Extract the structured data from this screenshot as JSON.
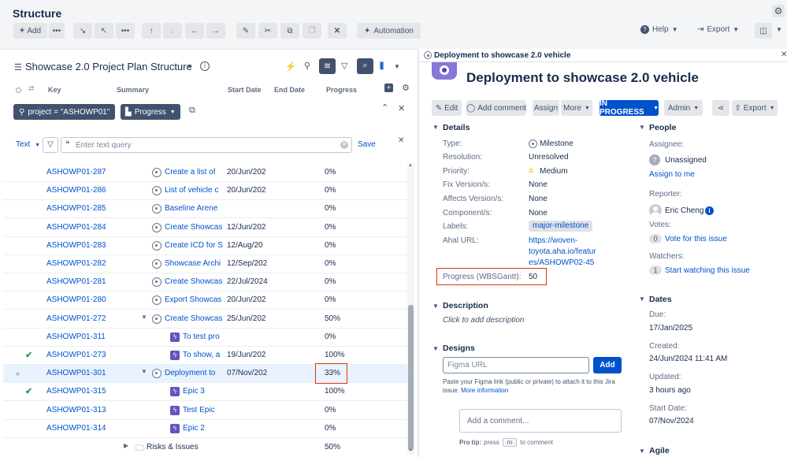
{
  "app": {
    "title": "Structure",
    "toolbar": {
      "add_label": "Add",
      "automation_label": "Automation",
      "help_label": "Help",
      "export_label": "Export"
    }
  },
  "structure": {
    "name": "Showcase 2.0 Project Plan Structure",
    "columns": {
      "key": "Key",
      "summary": "Summary",
      "start_date": "Start Date",
      "end_date": "End Date",
      "progress": "Progress"
    },
    "filter_chip": "project = \"ASHOWP01\"",
    "progress_chip": "Progress",
    "text_mode": "Text",
    "search_placeholder": "Enter text query",
    "save_label": "Save",
    "rows": [
      {
        "key": "ASHOWP01-287",
        "summary": "Create a list of",
        "start": "20/Jun/202",
        "progress": "0%",
        "type": "milestone",
        "indent": 0,
        "expand": "",
        "check": false,
        "dot": false
      },
      {
        "key": "ASHOWP01-286",
        "summary": "List of vehicle c",
        "start": "20/Jun/202",
        "progress": "0%",
        "type": "milestone",
        "indent": 0,
        "expand": "",
        "check": false,
        "dot": false
      },
      {
        "key": "ASHOWP01-285",
        "summary": "Baseline Arene",
        "start": "",
        "progress": "0%",
        "type": "milestone",
        "indent": 0,
        "expand": "",
        "check": false,
        "dot": false
      },
      {
        "key": "ASHOWP01-284",
        "summary": "Create Showcas",
        "start": "12/Jun/202",
        "progress": "0%",
        "type": "milestone",
        "indent": 0,
        "expand": "",
        "check": false,
        "dot": false
      },
      {
        "key": "ASHOWP01-283",
        "summary": "Create ICD for S",
        "start": "12/Aug/20",
        "progress": "0%",
        "type": "milestone",
        "indent": 0,
        "expand": "",
        "check": false,
        "dot": false
      },
      {
        "key": "ASHOWP01-282",
        "summary": "Showcase Archi",
        "start": "12/Sep/202",
        "progress": "0%",
        "type": "milestone",
        "indent": 0,
        "expand": "",
        "check": false,
        "dot": false
      },
      {
        "key": "ASHOWP01-281",
        "summary": "Create Showcas",
        "start": "22/Jul/2024",
        "progress": "0%",
        "type": "milestone",
        "indent": 0,
        "expand": "",
        "check": false,
        "dot": false
      },
      {
        "key": "ASHOWP01-280",
        "summary": "Export Showcas",
        "start": "20/Jun/202",
        "progress": "0%",
        "type": "milestone",
        "indent": 0,
        "expand": "",
        "check": false,
        "dot": false
      },
      {
        "key": "ASHOWP01-272",
        "summary": "Create Showcas",
        "start": "25/Jun/202",
        "progress": "50%",
        "type": "milestone",
        "indent": 0,
        "expand": "▼",
        "check": false,
        "dot": false
      },
      {
        "key": "ASHOWP01-311",
        "summary": "To test pro",
        "start": "",
        "progress": "0%",
        "type": "epic",
        "indent": 1,
        "expand": "",
        "check": false,
        "dot": false
      },
      {
        "key": "ASHOWP01-273",
        "summary": "To show, a",
        "start": "19/Jun/202",
        "progress": "100%",
        "type": "epic",
        "indent": 1,
        "expand": "",
        "check": true,
        "dot": false
      },
      {
        "key": "ASHOWP01-301",
        "summary": "Deployment to",
        "start": "07/Nov/202",
        "progress": "33%",
        "type": "milestone",
        "indent": 0,
        "expand": "▼",
        "check": false,
        "dot": true,
        "selected": true
      },
      {
        "key": "ASHOWP01-315",
        "summary": "Epic 3",
        "start": "",
        "progress": "100%",
        "type": "epic",
        "indent": 1,
        "expand": "",
        "check": true,
        "dot": false
      },
      {
        "key": "ASHOWP01-313",
        "summary": "Test Epic",
        "start": "",
        "progress": "0%",
        "type": "epic",
        "indent": 1,
        "expand": "",
        "check": false,
        "dot": false
      },
      {
        "key": "ASHOWP01-314",
        "summary": "Epic 2",
        "start": "",
        "progress": "0%",
        "type": "epic",
        "indent": 1,
        "expand": "",
        "check": false,
        "dot": false
      }
    ],
    "folder_row": {
      "label": "Risks & Issues",
      "progress": "50%"
    }
  },
  "issue": {
    "panel_title": "Deployment to showcase 2.0 vehicle",
    "title": "Deployment to showcase 2.0 vehicle",
    "actions": {
      "edit": "Edit",
      "add_comment": "Add comment",
      "assign": "Assign",
      "more": "More",
      "status": "IN PROGRESS",
      "admin": "Admin",
      "export": "Export"
    },
    "details": {
      "heading": "Details",
      "type_label": "Type:",
      "type_value": "Milestone",
      "resolution_label": "Resolution:",
      "resolution_value": "Unresolved",
      "priority_label": "Priority:",
      "priority_value": "Medium",
      "fix_label": "Fix Version/s:",
      "fix_value": "None",
      "affects_label": "Affects Version/s:",
      "affects_value": "None",
      "component_label": "Component/s:",
      "component_value": "None",
      "labels_label": "Labels:",
      "labels_value": "major-milestone",
      "aha_label": "Ahal URL:",
      "aha_value_1": "https://woven-",
      "aha_value_2": "toyota.aha.io/featur",
      "aha_value_3": "es/ASHOWP02-45",
      "progress_label": "Progress (WBSGantt):",
      "progress_value": "50"
    },
    "description": {
      "heading": "Description",
      "placeholder": "Click to add description"
    },
    "designs": {
      "heading": "Designs",
      "input_placeholder": "Figma URL",
      "add_label": "Add",
      "hint": "Paste your Figma link (public or private) to attach it to this Jira issue.",
      "more_info": "More information"
    },
    "comment": {
      "placeholder": "Add a comment...",
      "pro_tip_label": "Pro tip:",
      "pro_tip_text_1": "press",
      "pro_tip_key": "m",
      "pro_tip_text_2": "to comment"
    },
    "people": {
      "heading": "People",
      "assignee_label": "Assignee:",
      "assignee_value": "Unassigned",
      "assign_to_me": "Assign to me",
      "reporter_label": "Reporter:",
      "reporter_value": "Eric Cheng",
      "votes_label": "Votes:",
      "votes_count": "0",
      "vote_link": "Vote for this issue",
      "watchers_label": "Watchers:",
      "watchers_count": "1",
      "watch_link": "Start watching this issue"
    },
    "dates": {
      "heading": "Dates",
      "due_label": "Due:",
      "due_value": "17/Jan/2025",
      "created_label": "Created:",
      "created_value": "24/Jun/2024 11:41 AM",
      "updated_label": "Updated:",
      "updated_value": "3 hours ago",
      "start_label": "Start Date:",
      "start_value": "07/Nov/2024"
    },
    "agile": {
      "heading": "Agile"
    }
  },
  "colors": {
    "accent": "#0052cc",
    "highlight_box": "#de350b",
    "status_bg": "#0052cc",
    "epic": "#6554c0",
    "check": "#2a9d4a"
  }
}
